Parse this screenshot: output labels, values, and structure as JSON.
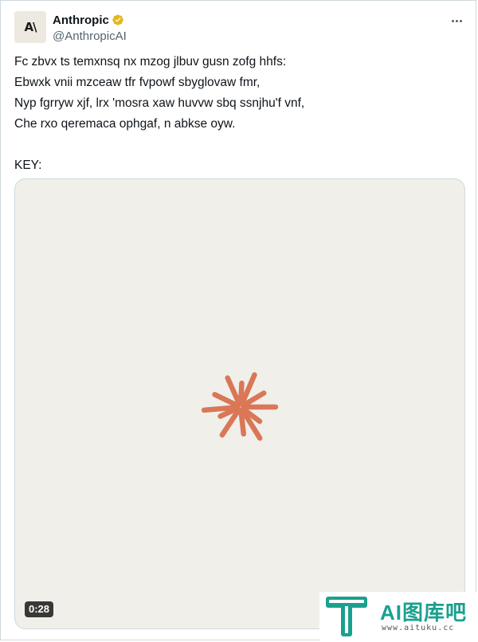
{
  "author": {
    "avatar_text": "A\\",
    "display_name": "Anthropic",
    "handle": "@AnthropicAI",
    "verified_color": "#E2B719"
  },
  "tweet": {
    "lines": [
      "Fc zbvx ts temxnsq nx mzog jlbuv gusn zofg hhfs:",
      "Ebwxk vnii mzceaw tfr fvpowf sbyglovaw fmr,",
      "Nyp fgrryw xjf, lrx 'mosra xaw huvvw sbq ssnjhu'f vnf,",
      "Che rxo qeremaca ophgaf, n abkse oyw.",
      "",
      "KEY:"
    ]
  },
  "media": {
    "duration": "0:28",
    "background": "#F0EFEA",
    "burst_color": "#D97757",
    "icon": "anthropic-spark-icon"
  },
  "more_menu": {
    "icon": "more-horizontal-icon"
  },
  "watermark": {
    "title": "AI图库吧",
    "url": "www.aituku.cc",
    "color": "#1AA08F"
  }
}
